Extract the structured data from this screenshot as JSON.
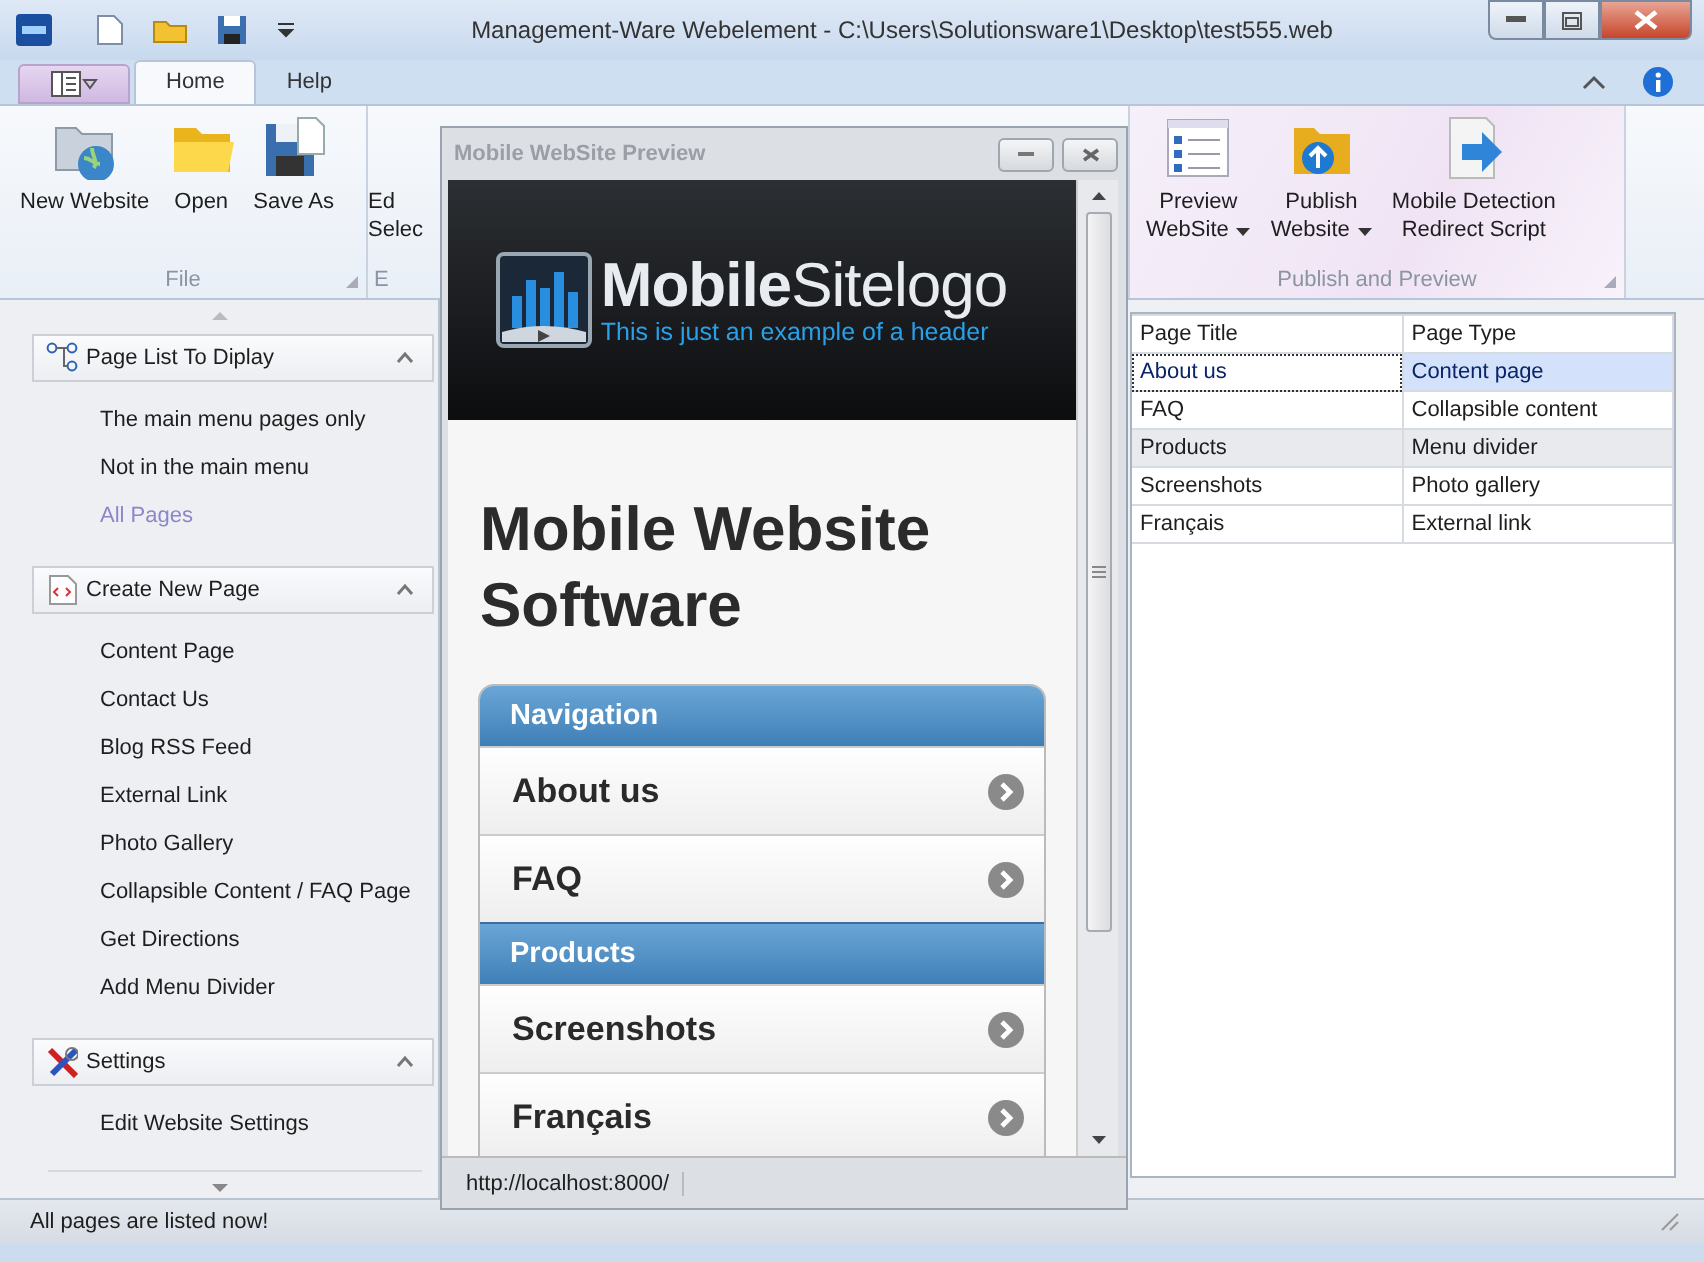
{
  "window": {
    "title": "Management-Ware Webelement - C:\\Users\\Solutionsware1\\Desktop\\test555.web"
  },
  "tabs": [
    {
      "label": "Home",
      "selected": true
    },
    {
      "label": "Help",
      "selected": false
    }
  ],
  "ribbon_groups": [
    {
      "label": "File",
      "buttons": [
        {
          "lines": [
            "New Website"
          ],
          "dropdown": false
        },
        {
          "lines": [
            "Open"
          ],
          "dropdown": false
        },
        {
          "lines": [
            "Save As"
          ],
          "dropdown": false
        }
      ]
    },
    {
      "label": "E",
      "buttons": [
        {
          "lines": [
            "Ed",
            "Selec"
          ],
          "dropdown": false
        }
      ]
    },
    {
      "label": "Publish and Preview",
      "buttons": [
        {
          "lines": [
            "Preview",
            "WebSite"
          ],
          "dropdown": true
        },
        {
          "lines": [
            "Publish",
            "Website"
          ],
          "dropdown": true
        },
        {
          "lines": [
            "Mobile Detection",
            "Redirect Script"
          ],
          "dropdown": false
        }
      ]
    }
  ],
  "sidebar": {
    "sections": [
      {
        "title": "Page List To Diplay",
        "expanded": true,
        "items": [
          {
            "label": "The main menu pages only",
            "selected": false
          },
          {
            "label": "Not in the main menu",
            "selected": false
          },
          {
            "label": "All Pages",
            "selected": true
          }
        ]
      },
      {
        "title": "Create New Page",
        "expanded": true,
        "items": [
          {
            "label": "Content Page",
            "selected": false
          },
          {
            "label": "Contact Us",
            "selected": false
          },
          {
            "label": "Blog RSS Feed",
            "selected": false
          },
          {
            "label": "External Link",
            "selected": false
          },
          {
            "label": "Photo Gallery",
            "selected": false
          },
          {
            "label": "Collapsible Content / FAQ Page",
            "selected": false
          },
          {
            "label": "Get Directions",
            "selected": false
          },
          {
            "label": "Add Menu Divider",
            "selected": false
          }
        ]
      },
      {
        "title": "Settings",
        "expanded": true,
        "items": [
          {
            "label": "Edit Website Settings",
            "selected": false
          }
        ]
      }
    ]
  },
  "preview": {
    "title": "Mobile WebSite Preview",
    "logo": "**Mobile**Sitelogo",
    "tagline": "This is just an example of a header",
    "heading": "Mobile Website Software",
    "nav": [
      {
        "kind": "header",
        "label": "Navigation"
      },
      {
        "kind": "link",
        "label": "About us"
      },
      {
        "kind": "link",
        "label": "FAQ"
      },
      {
        "kind": "header",
        "label": "Products"
      },
      {
        "kind": "link",
        "label": "Screenshots"
      },
      {
        "kind": "link",
        "label": "Français"
      }
    ],
    "url": "http://localhost:8000/"
  },
  "table": {
    "columns": [
      "Page Title",
      "Page Type"
    ],
    "rows": [
      {
        "cells": [
          "About us",
          "Content page"
        ],
        "selected": true,
        "kind": "page"
      },
      {
        "cells": [
          "FAQ",
          "Collapsible content"
        ],
        "selected": false,
        "kind": "page"
      },
      {
        "cells": [
          "Products",
          "Menu divider"
        ],
        "selected": false,
        "kind": "divider"
      },
      {
        "cells": [
          "Screenshots",
          "Photo gallery"
        ],
        "selected": false,
        "kind": "page"
      },
      {
        "cells": [
          "Français",
          "External link"
        ],
        "selected": false,
        "kind": "page"
      }
    ]
  },
  "status_bar": {
    "text": "All pages are listed now!"
  }
}
